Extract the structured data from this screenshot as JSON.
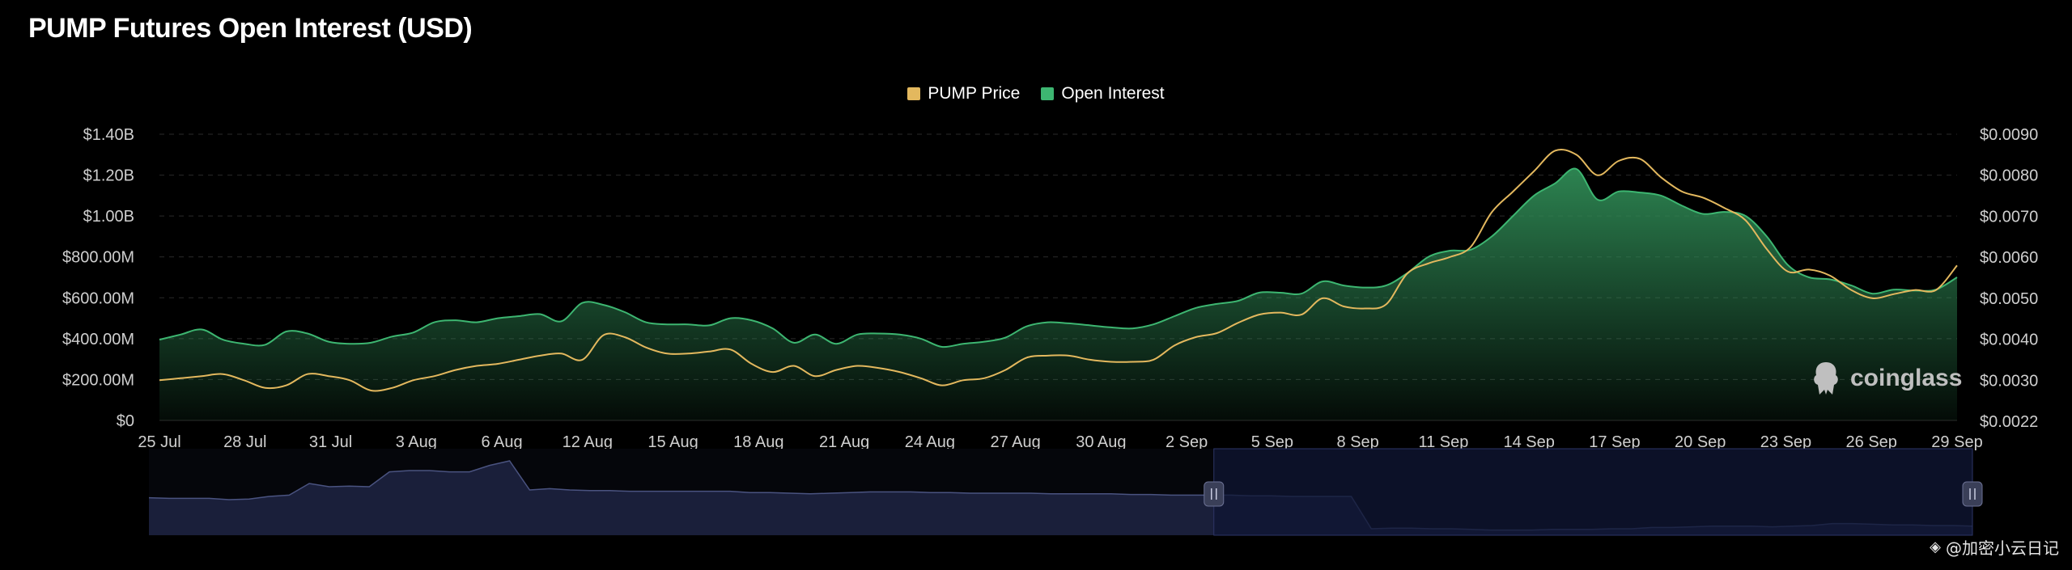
{
  "title": "PUMP Futures Open Interest (USD)",
  "legend": [
    {
      "label": "PUMP Price",
      "color": "#e3b85e"
    },
    {
      "label": "Open Interest",
      "color": "#3db671"
    }
  ],
  "brand": "coinglass",
  "watermark": "@加密小云日记",
  "colors": {
    "background": "#000000",
    "price_line": "#e3b85e",
    "oi_line": "#3db671",
    "oi_fill_top": "#2f8a55",
    "navigator_fill": "#1a1f3a",
    "navigator_line": "#4a5380",
    "navigator_selection": "#0f1633"
  },
  "chart_data": {
    "type": "area",
    "title": "PUMP Futures Open Interest (USD)",
    "x_tick_labels": [
      "25 Jul",
      "28 Jul",
      "31 Jul",
      "3 Aug",
      "6 Aug",
      "12 Aug",
      "15 Aug",
      "18 Aug",
      "21 Aug",
      "24 Aug",
      "27 Aug",
      "30 Aug",
      "2 Sep",
      "5 Sep",
      "8 Sep",
      "11 Sep",
      "14 Sep",
      "17 Sep",
      "20 Sep",
      "23 Sep",
      "26 Sep",
      "29 Sep"
    ],
    "y_left_ticks": [
      "$0",
      "$200.00M",
      "$400.00M",
      "$600.00M",
      "$800.00M",
      "$1.00B",
      "$1.20B",
      "$1.40B"
    ],
    "y_left_values": [
      0,
      200000000,
      400000000,
      600000000,
      800000000,
      1000000000,
      1200000000,
      1400000000
    ],
    "y_right_ticks": [
      "$0.0022",
      "$0.0030",
      "$0.0040",
      "$0.0050",
      "$0.0060",
      "$0.0070",
      "$0.0080",
      "$0.0090"
    ],
    "y_right_values": [
      0.0022,
      0.003,
      0.004,
      0.005,
      0.006,
      0.007,
      0.008,
      0.009
    ],
    "ylim_left": [
      0,
      1400000000
    ],
    "ylim_right_labels": [
      "$0.0022",
      "$0.0090"
    ],
    "grid": true,
    "legend_position": "top-center",
    "series": [
      {
        "name": "Open Interest",
        "axis": "left",
        "values": [
          395000000,
          420000000,
          445000000,
          395000000,
          375000000,
          370000000,
          435000000,
          425000000,
          385000000,
          375000000,
          380000000,
          410000000,
          430000000,
          480000000,
          490000000,
          480000000,
          500000000,
          510000000,
          520000000,
          485000000,
          575000000,
          565000000,
          530000000,
          480000000,
          470000000,
          470000000,
          465000000,
          500000000,
          490000000,
          450000000,
          380000000,
          420000000,
          375000000,
          420000000,
          425000000,
          420000000,
          400000000,
          360000000,
          375000000,
          385000000,
          405000000,
          460000000,
          480000000,
          475000000,
          465000000,
          455000000,
          450000000,
          470000000,
          510000000,
          550000000,
          570000000,
          585000000,
          625000000,
          625000000,
          620000000,
          680000000,
          660000000,
          650000000,
          660000000,
          720000000,
          800000000,
          830000000,
          835000000,
          900000000,
          1000000000,
          1100000000,
          1160000000,
          1230000000,
          1080000000,
          1120000000,
          1115000000,
          1100000000,
          1050000000,
          1010000000,
          1020000000,
          1000000000,
          900000000,
          760000000,
          700000000,
          690000000,
          660000000,
          620000000,
          640000000,
          635000000,
          640000000,
          700000000
        ]
      },
      {
        "name": "PUMP Price",
        "axis": "right",
        "values": [
          0.003,
          0.00305,
          0.0031,
          0.00315,
          0.003,
          0.00285,
          0.0029,
          0.00315,
          0.0031,
          0.003,
          0.0028,
          0.00285,
          0.003,
          0.0031,
          0.00325,
          0.00335,
          0.0034,
          0.0035,
          0.0036,
          0.00365,
          0.0035,
          0.0041,
          0.00405,
          0.0038,
          0.00365,
          0.00365,
          0.0037,
          0.00375,
          0.0034,
          0.0032,
          0.00335,
          0.0031,
          0.00325,
          0.00335,
          0.0033,
          0.0032,
          0.00305,
          0.0029,
          0.003,
          0.00305,
          0.00325,
          0.00355,
          0.0036,
          0.0036,
          0.0035,
          0.00345,
          0.00345,
          0.0035,
          0.00385,
          0.00405,
          0.00415,
          0.0044,
          0.0046,
          0.00465,
          0.0046,
          0.005,
          0.0048,
          0.00475,
          0.00485,
          0.0056,
          0.00585,
          0.006,
          0.00625,
          0.0071,
          0.0076,
          0.0081,
          0.0086,
          0.0085,
          0.008,
          0.00835,
          0.0084,
          0.00795,
          0.0076,
          0.00745,
          0.0072,
          0.0069,
          0.0062,
          0.00565,
          0.0057,
          0.00555,
          0.0052,
          0.005,
          0.0051,
          0.0052,
          0.0052,
          0.0058
        ]
      }
    ],
    "navigator": {
      "values": [
        0.58,
        0.57,
        0.57,
        0.57,
        0.55,
        0.56,
        0.6,
        0.62,
        0.8,
        0.75,
        0.76,
        0.75,
        0.98,
        1.0,
        1.0,
        0.98,
        0.98,
        1.08,
        1.15,
        0.7,
        0.72,
        0.7,
        0.69,
        0.69,
        0.68,
        0.68,
        0.68,
        0.68,
        0.68,
        0.68,
        0.66,
        0.66,
        0.65,
        0.64,
        0.65,
        0.66,
        0.67,
        0.67,
        0.67,
        0.66,
        0.66,
        0.65,
        0.65,
        0.65,
        0.65,
        0.64,
        0.64,
        0.64,
        0.64,
        0.63,
        0.63,
        0.62,
        0.62,
        0.62,
        0.62,
        0.61,
        0.61,
        0.6,
        0.6,
        0.6,
        0.6,
        0.1,
        0.11,
        0.11,
        0.1,
        0.1,
        0.09,
        0.08,
        0.08,
        0.08,
        0.09,
        0.09,
        0.09,
        0.1,
        0.1,
        0.12,
        0.12,
        0.13,
        0.14,
        0.14,
        0.14,
        0.13,
        0.14,
        0.15,
        0.18,
        0.18,
        0.17,
        0.16,
        0.16,
        0.15,
        0.15,
        0.14
      ],
      "selection_start_fraction": 0.584,
      "selection_end_fraction": 1.0
    }
  }
}
